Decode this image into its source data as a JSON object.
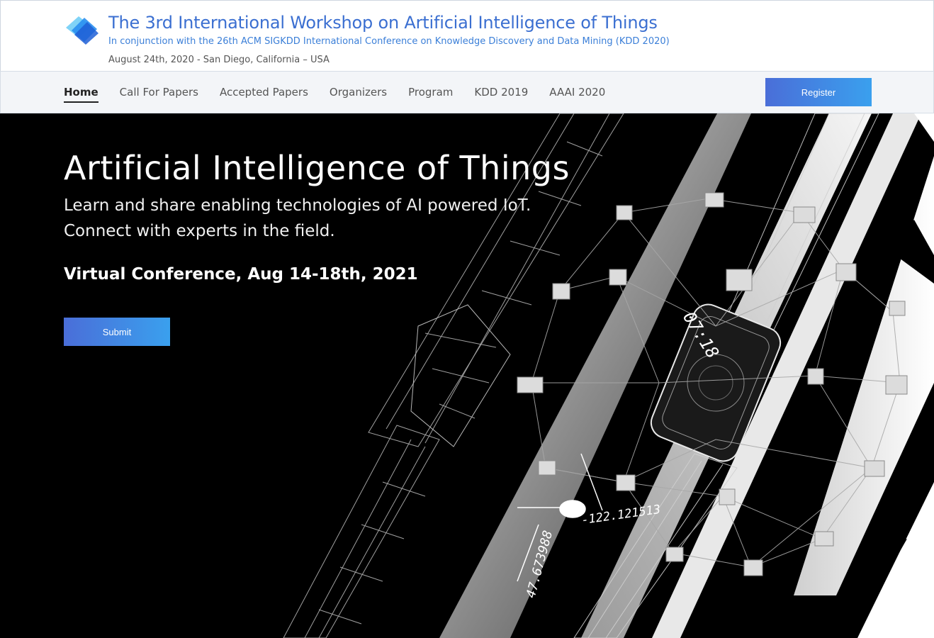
{
  "header": {
    "title": "The 3rd International Workshop on Artificial Intelligence of Things",
    "subtitle": "In conjunction with the 26th ACM SIGKDD International Conference on Knowledge Discovery and Data Mining (KDD 2020)",
    "date_location": "August 24th, 2020 - San Diego, California – USA",
    "logo_icon": "layered-squares-logo-icon"
  },
  "nav": {
    "items": [
      {
        "label": "Home",
        "active": true
      },
      {
        "label": "Call For Papers",
        "active": false
      },
      {
        "label": "Accepted Papers",
        "active": false
      },
      {
        "label": "Organizers",
        "active": false
      },
      {
        "label": "Program",
        "active": false
      },
      {
        "label": "KDD 2019",
        "active": false
      },
      {
        "label": "AAAI 2020",
        "active": false
      }
    ],
    "register_label": "Register"
  },
  "hero": {
    "title": "Artificial Intelligence of Things",
    "tagline_line1": "Learn and share enabling technologies of AI powered IoT.",
    "tagline_line2": "Connect with experts in the field.",
    "event": "Virtual Conference, Aug 14-18th, 2021",
    "submit_label": "Submit",
    "art": {
      "time_readout": "07:18",
      "coordinate_a": "-122.121513",
      "coordinate_b": "47.673988"
    }
  },
  "colors": {
    "title_blue": "#3b6fd1",
    "subtitle_blue": "#3b7fd8",
    "button_gradient_start": "#4a6ed8",
    "button_gradient_end": "#3aa0ee",
    "nav_bg": "#f3f5f8",
    "hero_bg": "#000000"
  }
}
